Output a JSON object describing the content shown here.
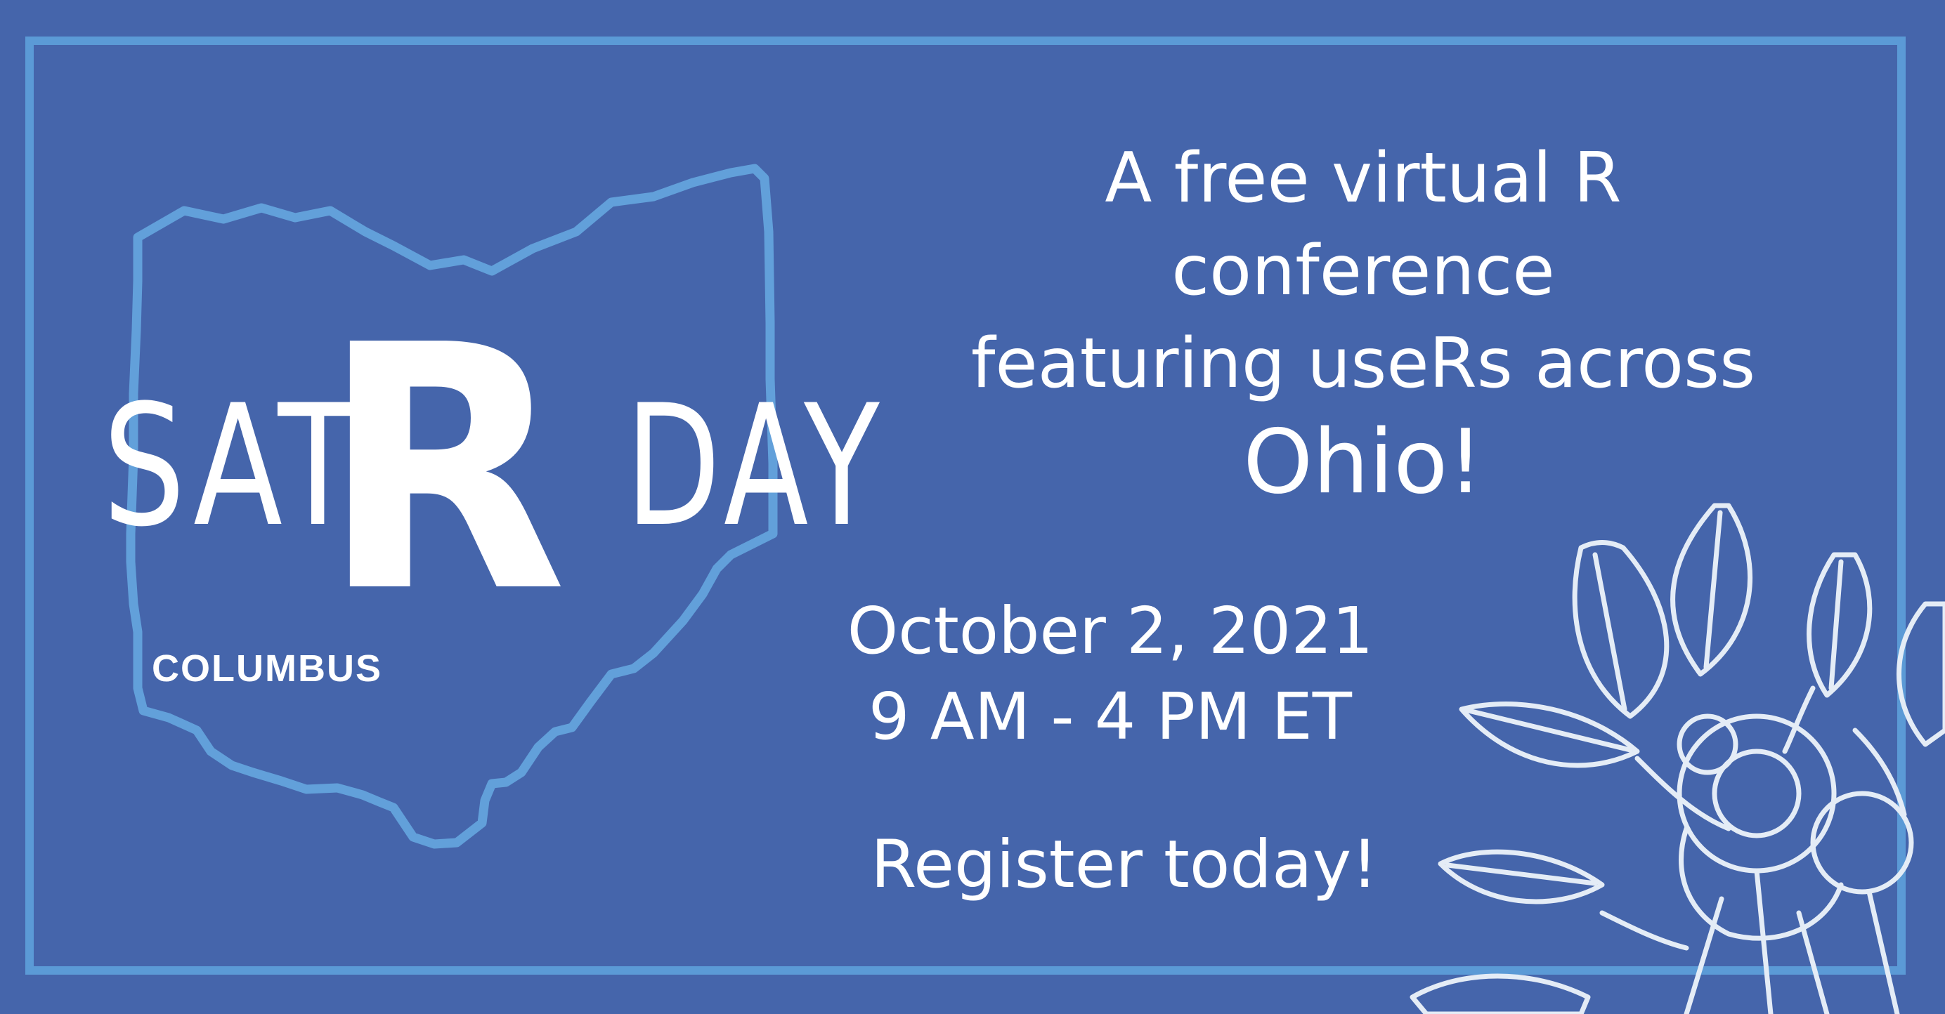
{
  "logo": {
    "sat": "SAT",
    "r": "R",
    "day": "DAY",
    "subtitle": "COLUMBUS"
  },
  "headline": {
    "line1": "A free virtual R",
    "line2": "conference",
    "line3": "featuring useRs across",
    "line4": "Ohio!"
  },
  "event": {
    "date": "October 2, 2021",
    "time": "9 AM - 4 PM ET"
  },
  "cta": "Register today!",
  "colors": {
    "background": "#4565ab",
    "border": "#5b9ad6",
    "ohio_outline": "#62a0da",
    "text": "#ffffff",
    "flower": "#e4ecf6"
  },
  "icons": {
    "state": "ohio-outline-icon",
    "decoration": "flower-illustration-icon"
  }
}
